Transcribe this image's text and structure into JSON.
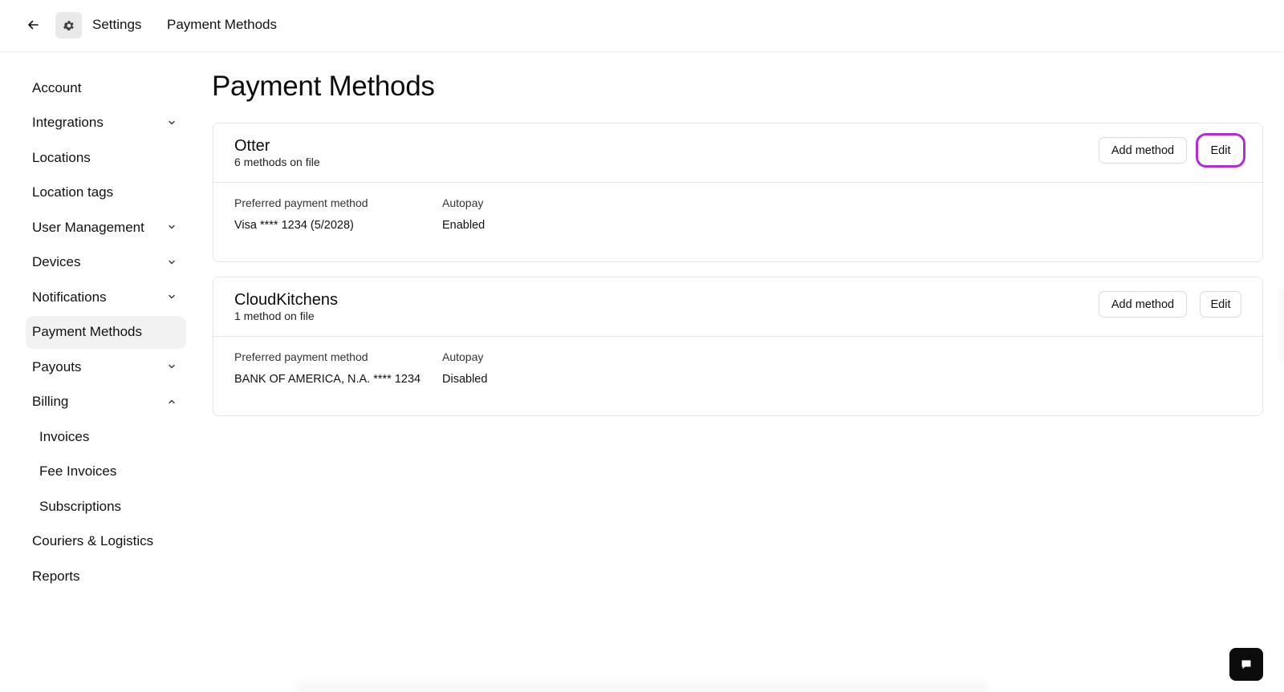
{
  "header": {
    "settings_label": "Settings",
    "current_label": "Payment Methods",
    "icons": {
      "back": "arrow-left-icon",
      "settings": "gear-icon"
    }
  },
  "sidebar": {
    "items": [
      {
        "label": "Account",
        "chevron": ""
      },
      {
        "label": "Integrations",
        "chevron": "down"
      },
      {
        "label": "Locations",
        "chevron": ""
      },
      {
        "label": "Location tags",
        "chevron": ""
      },
      {
        "label": "User Management",
        "chevron": "down"
      },
      {
        "label": "Devices",
        "chevron": "down"
      },
      {
        "label": "Notifications",
        "chevron": "down"
      },
      {
        "label": "Payment Methods",
        "chevron": "",
        "active": true
      },
      {
        "label": "Payouts",
        "chevron": "down"
      },
      {
        "label": "Billing",
        "chevron": "up"
      },
      {
        "label": "Invoices",
        "chevron": "",
        "sub": true
      },
      {
        "label": "Fee Invoices",
        "chevron": "",
        "sub": true
      },
      {
        "label": "Subscriptions",
        "chevron": "",
        "sub": true
      },
      {
        "label": "Couriers & Logistics",
        "chevron": ""
      },
      {
        "label": "Reports",
        "chevron": ""
      }
    ]
  },
  "main": {
    "title": "Payment Methods",
    "cards": [
      {
        "name": "Otter",
        "count": "6 methods on file",
        "add_label": "Add method",
        "edit_label": "Edit",
        "edit_highlighted": true,
        "preferred_label": "Preferred payment method",
        "preferred_value": "Visa **** 1234 (5/2028)",
        "autopay_label": "Autopay",
        "autopay_value": "Enabled"
      },
      {
        "name": "CloudKitchens",
        "count": "1 method on file",
        "add_label": "Add method",
        "edit_label": "Edit",
        "edit_highlighted": false,
        "preferred_label": "Preferred payment method",
        "preferred_value": "BANK OF AMERICA, N.A. **** 1234",
        "autopay_label": "Autopay",
        "autopay_value": "Disabled"
      }
    ]
  },
  "colors": {
    "highlight": "#b52bd9",
    "active_nav_bg": "#f2f2f2",
    "fab_bg": "#0c0c0c"
  },
  "chat": {
    "icon": "chat-bubble-icon"
  }
}
